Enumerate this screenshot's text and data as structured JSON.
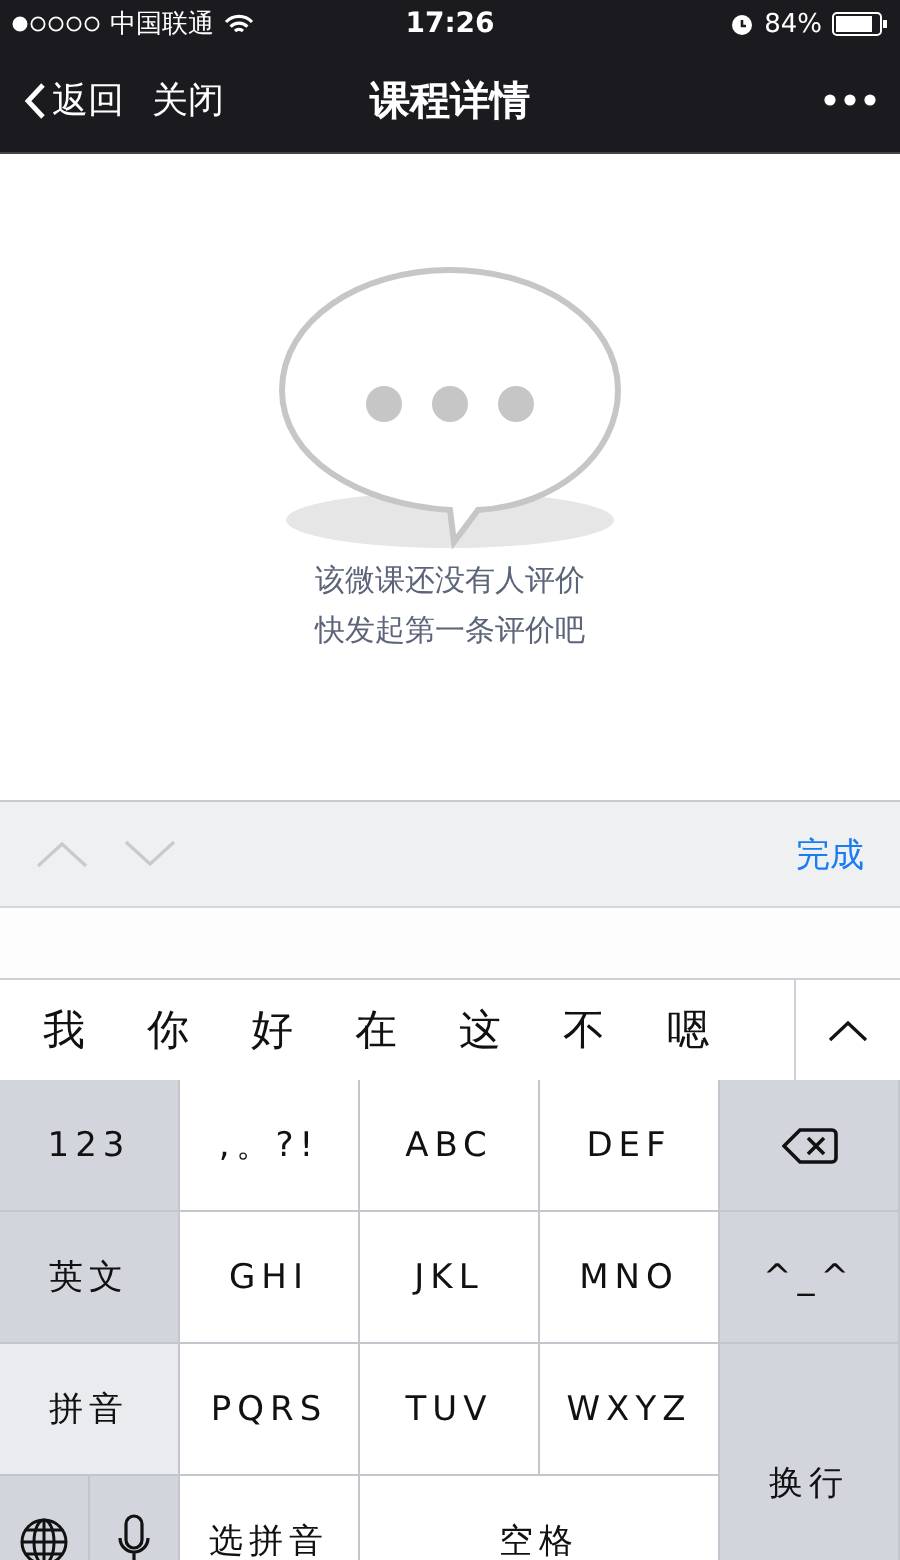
{
  "status_bar": {
    "carrier": "中国联通",
    "time": "17:26",
    "battery": "84%"
  },
  "nav": {
    "back": "返回",
    "close": "关闭",
    "title": "课程详情"
  },
  "empty_state": {
    "lines": [
      "该微课还没有人评价",
      "快发起第一条评价吧"
    ]
  },
  "toolbar": {
    "done": "完成"
  },
  "candidates": [
    "我",
    "你",
    "好",
    "在",
    "这",
    "不",
    "嗯"
  ],
  "keys": [
    {
      "kind": "function",
      "label": "123"
    },
    {
      "kind": "char",
      "label": ",。?!"
    },
    {
      "kind": "char",
      "label": "ABC"
    },
    {
      "kind": "char",
      "label": "DEF"
    },
    {
      "kind": "delete"
    },
    {
      "kind": "mode",
      "label": "英文",
      "selected": false
    },
    {
      "kind": "char",
      "label": "GHI"
    },
    {
      "kind": "char",
      "label": "JKL"
    },
    {
      "kind": "char",
      "label": "MNO"
    },
    {
      "kind": "function",
      "label": "^_^"
    },
    {
      "kind": "mode",
      "label": "拼音",
      "selected": true
    },
    {
      "kind": "char",
      "label": "PQRS"
    },
    {
      "kind": "char",
      "label": "TUV"
    },
    {
      "kind": "char",
      "label": "WXYZ"
    },
    {
      "kind": "return",
      "label": "换行"
    },
    {
      "kind": "globe"
    },
    {
      "kind": "mic"
    },
    {
      "kind": "char",
      "label": "选拼音"
    },
    {
      "kind": "space",
      "label": "空格"
    }
  ]
}
